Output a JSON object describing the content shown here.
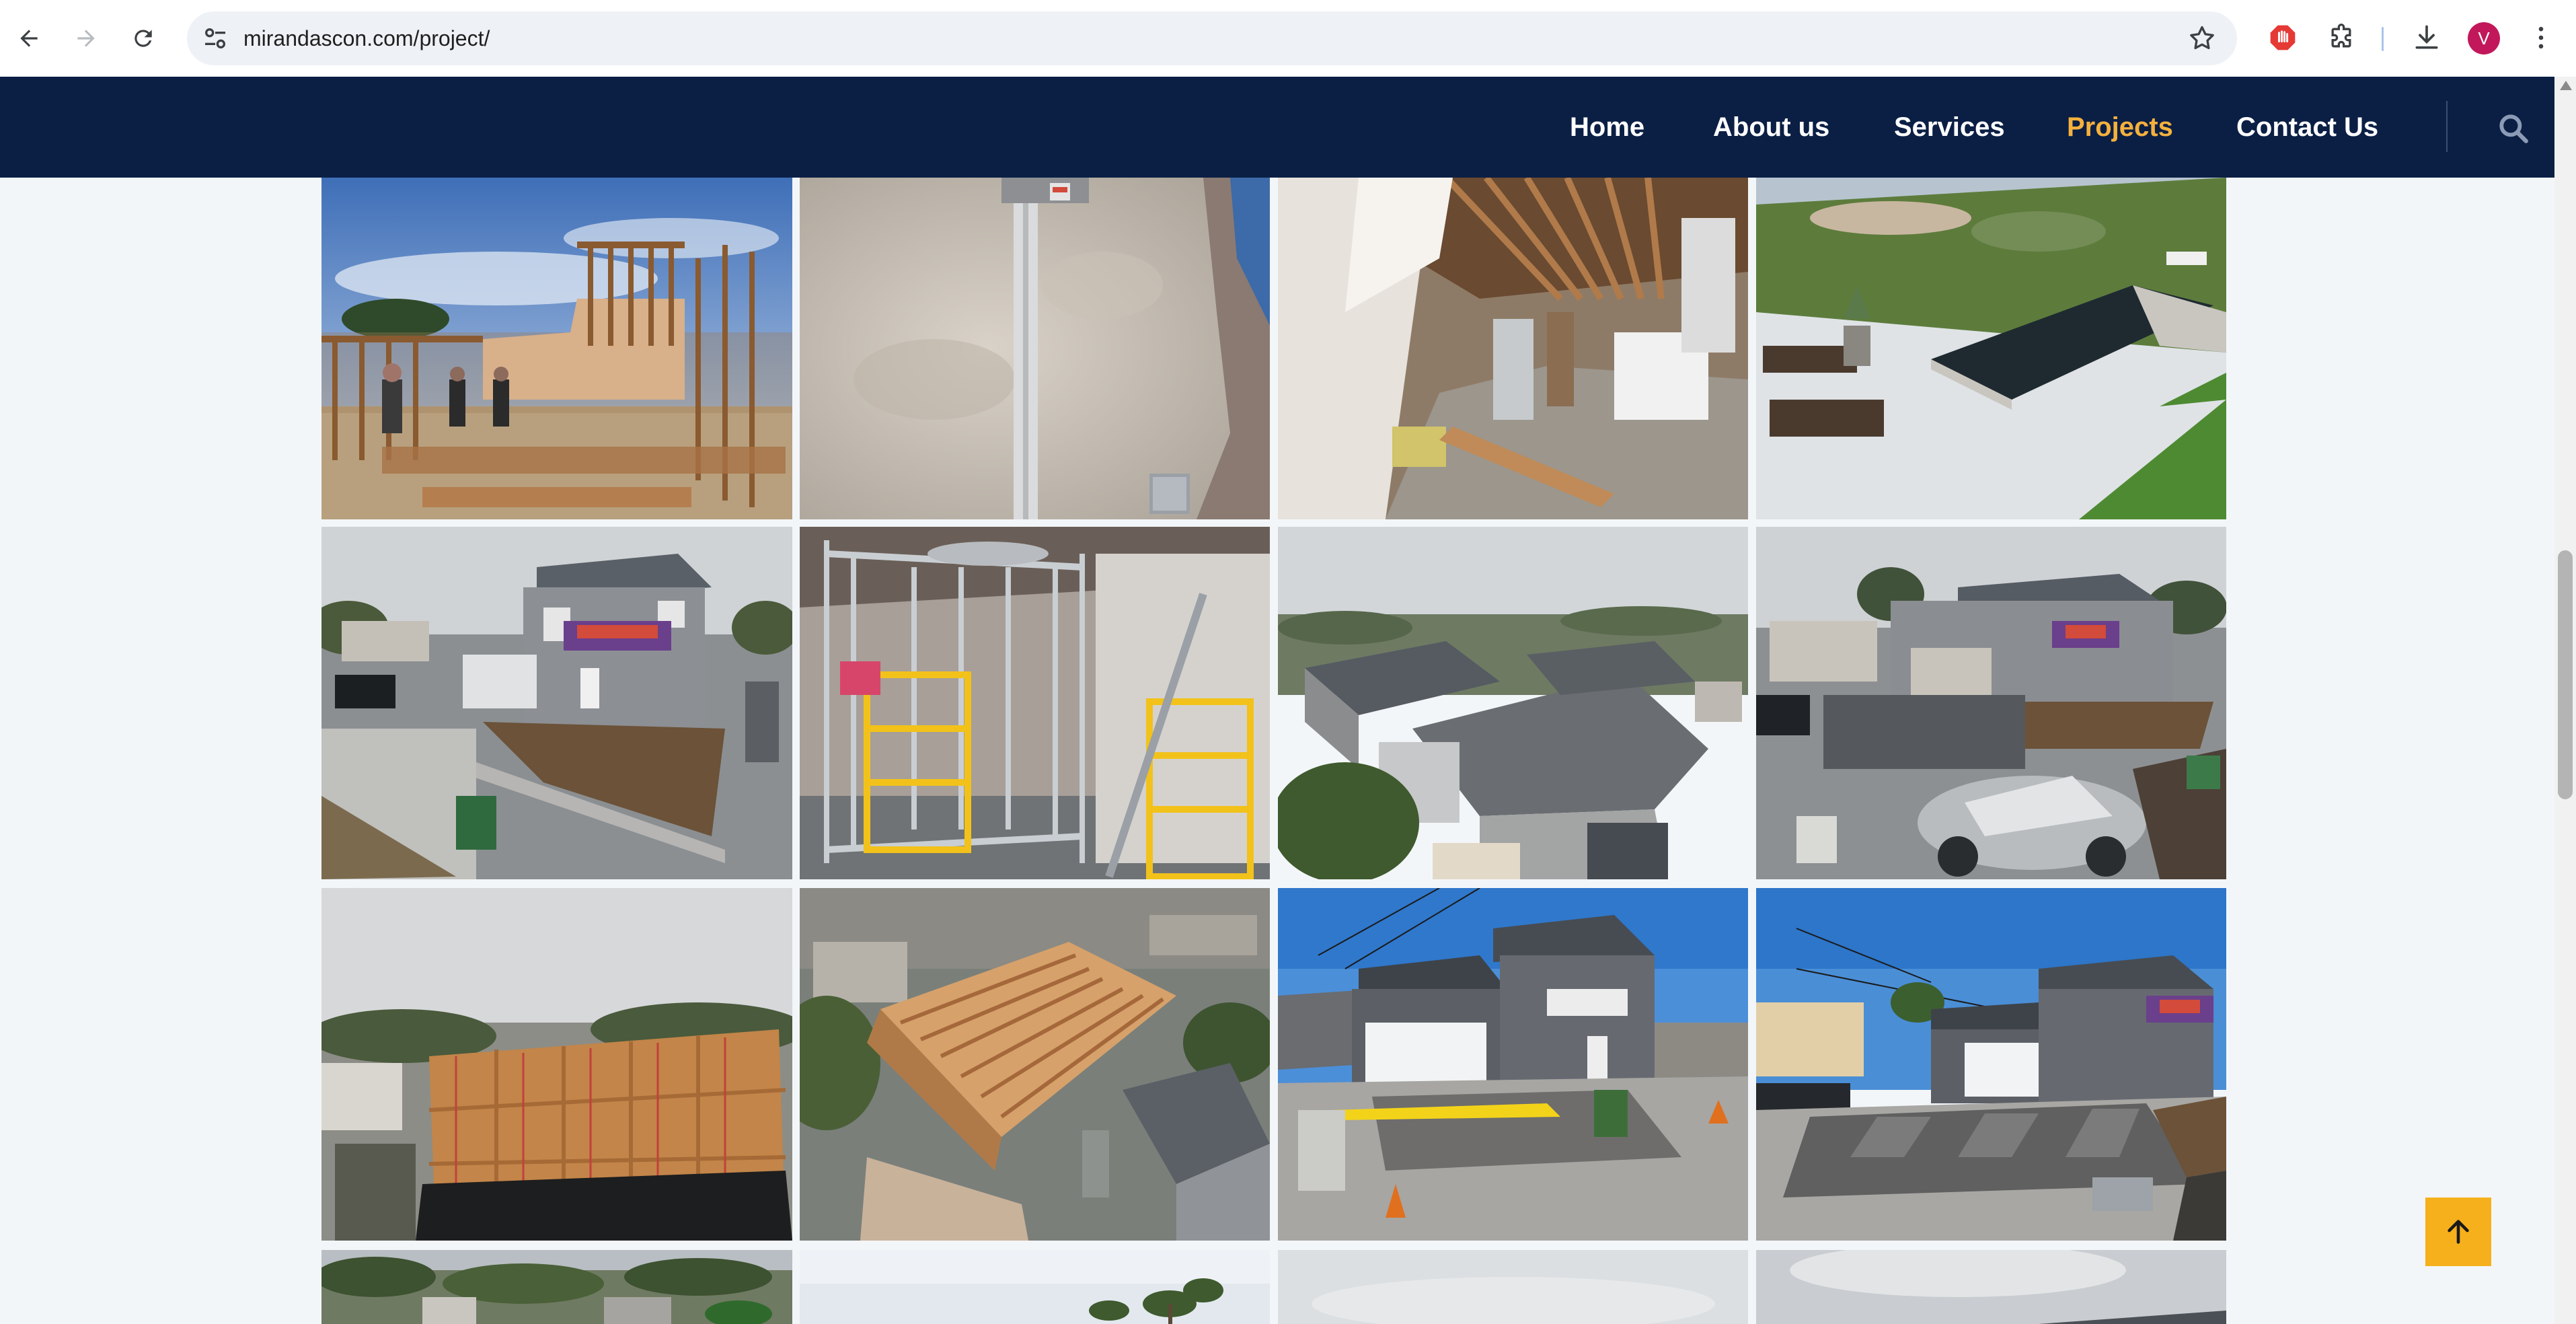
{
  "browser": {
    "url": "mirandascon.com/project/",
    "profile_initial": "V",
    "icons": [
      "back-icon",
      "forward-icon",
      "reload-icon",
      "site-settings-icon",
      "bookmark-star-icon",
      "adblock-icon",
      "extensions-icon",
      "download-icon",
      "menu-kebab-icon"
    ]
  },
  "header": {
    "nav": [
      {
        "label": "Home",
        "active": false
      },
      {
        "label": "About us",
        "active": false
      },
      {
        "label": "Services",
        "active": false
      },
      {
        "label": "Projects",
        "active": true
      },
      {
        "label": "Contact Us",
        "active": false
      }
    ],
    "search_icon": "search-icon"
  },
  "gallery": {
    "photos": [
      "wood-framing-crew",
      "stucco-wall-conduit",
      "interior-demolition",
      "infinity-pool-deck",
      "two-story-home-yard",
      "metal-stud-framing-scaffold",
      "aerial-roof-view",
      "two-story-home-driveway-car",
      "apartment-framing-scaffold",
      "aerial-roof-trusses",
      "home-garage-new-driveway",
      "home-finished-driveway",
      "aerial-neighborhood",
      "palm-trees-sky",
      "overcast-sky",
      "overcast-sky-roofline"
    ]
  },
  "back_to_top": {
    "icon": "arrow-up-icon"
  },
  "colors": {
    "header_bg": "#0b1f45",
    "nav_active": "#f5b13d",
    "back_to_top_bg": "#f5b01c",
    "page_bg": "#f3f6f9"
  }
}
